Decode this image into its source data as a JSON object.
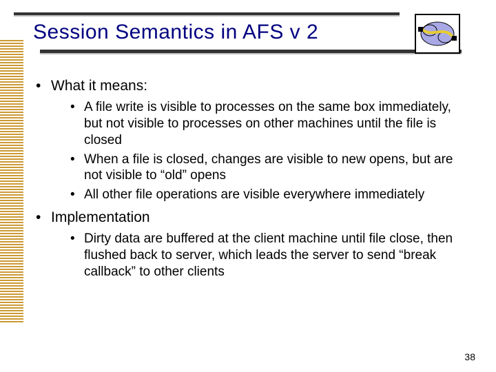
{
  "title": "Session Semantics in AFS v 2",
  "sections": [
    {
      "label": "What it means:",
      "bullets": [
        "A file write is visible to processes on the same box immediately, but not visible to processes on other machines until the file is closed",
        "When a file is closed, changes are visible to new opens, but are not visible to “old” opens",
        "All other file operations are visible everywhere immediately"
      ]
    },
    {
      "label": "Implementation",
      "bullets": [
        "Dirty data are buffered at the client machine until file close, then flushed back to server, which leads the server to send “break callback” to other clients"
      ]
    }
  ],
  "page_number": "38"
}
